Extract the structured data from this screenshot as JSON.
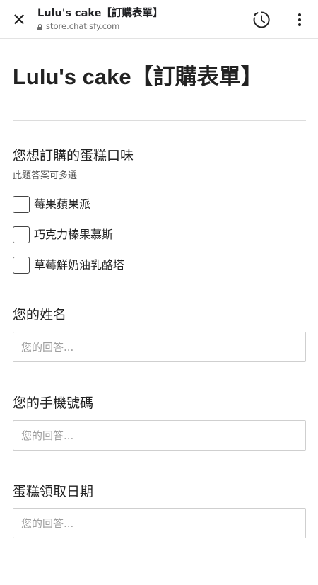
{
  "topbar": {
    "title": "Lulu's cake【訂購表單】",
    "url": "store.chatisfy.com",
    "close_icon": "close-icon",
    "history_icon": "history-icon",
    "menu_icon": "more-vert-icon"
  },
  "form": {
    "title": "Lulu's cake【訂購表單】",
    "flavor_question": {
      "label": "您想訂購的蛋糕口味",
      "hint": "此題答案可多選",
      "options": [
        "莓果蘋果派",
        "巧克力榛果慕斯",
        "草莓鮮奶油乳酪塔"
      ]
    },
    "name_question": {
      "label": "您的姓名",
      "placeholder": "您的回答..."
    },
    "phone_question": {
      "label": "您的手機號碼",
      "placeholder": "您的回答..."
    },
    "date_question": {
      "label": "蛋糕領取日期",
      "placeholder": "您的回答..."
    }
  }
}
